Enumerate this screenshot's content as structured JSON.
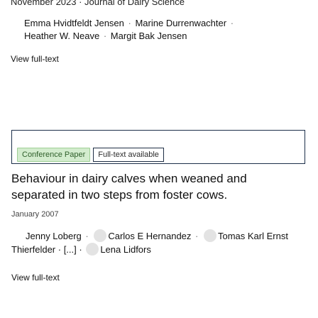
{
  "item1": {
    "meta": "November 2023 · Journal of Dairy Science",
    "authors_line1": [
      {
        "name": "Emma Hvidtfeldt Jensen",
        "sep": " · "
      },
      {
        "name": "Marine Durrenwachter",
        "sep": " ·"
      }
    ],
    "authors_line2": [
      {
        "name": "Heather W. Neave",
        "sep": " · "
      },
      {
        "name": "Margit Bak Jensen",
        "sep": ""
      }
    ],
    "view_label": "View full-text"
  },
  "item2": {
    "badges": {
      "type_label": "Conference Paper",
      "fulltext_label": "Full-text available"
    },
    "title": "Behaviour in dairy calves when weaned and separated in two steps from foster cows.",
    "date": "January 2007",
    "authors_line1": [
      {
        "name": "Jenny Loberg",
        "sep": " · "
      },
      {
        "name": "Carlos E Hernandez",
        "sep": " · "
      },
      {
        "name": "Tomas Karl Ernst",
        "sep": ""
      }
    ],
    "authors_line2_prefix": "Thierfelder · [...] · ",
    "last_author": "Lena Lidfors",
    "view_label": "View full-text"
  }
}
